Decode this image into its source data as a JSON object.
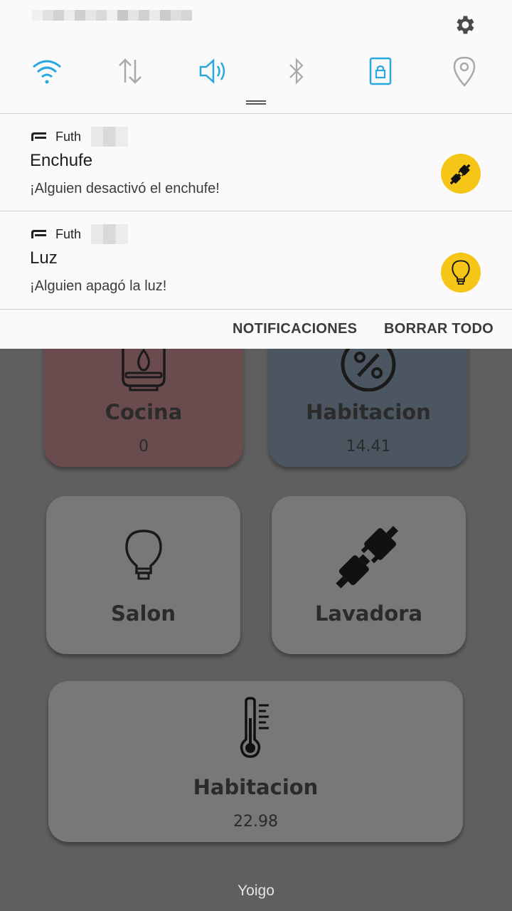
{
  "quick_settings": {
    "icons": [
      "wifi-icon",
      "mobile-data-icon",
      "sound-icon",
      "bluetooth-icon",
      "screen-lock-icon",
      "location-icon"
    ],
    "active_color": "#29a7e1",
    "inactive_color": "#a9a9a9"
  },
  "notifications": [
    {
      "app_name": "Futh",
      "title": "Enchufe",
      "text": "¡Alguien desactivó el enchufe!",
      "icon": "plug-icon"
    },
    {
      "app_name": "Futh",
      "title": "Luz",
      "text": "¡Alguien apagó la luz!",
      "icon": "lightbulb-icon"
    }
  ],
  "actions": {
    "notifications_label": "NOTIFICACIONES",
    "clear_all_label": "BORRAR TODO"
  },
  "background_app": {
    "cards": [
      {
        "title": "Cocina",
        "value": "0",
        "icon": "gas-icon"
      },
      {
        "title": "Habitacion",
        "value": "14.41",
        "icon": "humidity-icon"
      },
      {
        "title": "Salon",
        "icon": "lightbulb-icon"
      },
      {
        "title": "Lavadora",
        "icon": "plug-icon"
      },
      {
        "title": "Habitacion",
        "value": "22.98",
        "icon": "thermometer-icon"
      }
    ]
  },
  "status_bar": {
    "carrier": "Yoigo"
  },
  "colors": {
    "badge": "#f5c518",
    "cocina_card": "#6a4c4f",
    "habitacion_card": "#4b5660"
  }
}
